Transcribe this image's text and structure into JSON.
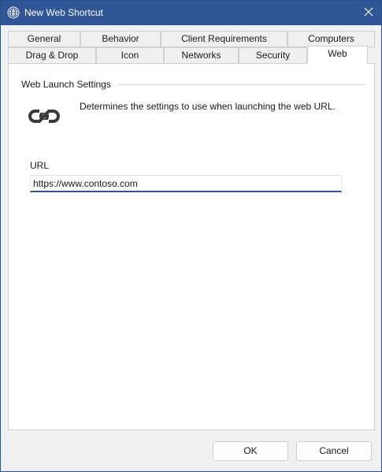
{
  "window": {
    "title": "New Web Shortcut",
    "app_icon": "globe-icon",
    "close_icon": "close-icon"
  },
  "tabs": {
    "row_back": [
      {
        "label": "General"
      },
      {
        "label": "Behavior"
      },
      {
        "label": "Client Requirements"
      },
      {
        "label": "Computers"
      }
    ],
    "row_front": [
      {
        "label": "Drag & Drop"
      },
      {
        "label": "Icon"
      },
      {
        "label": "Networks"
      },
      {
        "label": "Security"
      },
      {
        "label": "Web"
      }
    ],
    "active": "Web"
  },
  "web_panel": {
    "group_title": "Web Launch Settings",
    "icon": "link-icon",
    "description": "Determines the settings to use when launching the web URL.",
    "url_label": "URL",
    "url_value": "https://www.contoso.com"
  },
  "footer": {
    "ok_label": "OK",
    "cancel_label": "Cancel"
  },
  "colors": {
    "titlebar": "#2f5597",
    "input_focus": "#2f5597"
  }
}
